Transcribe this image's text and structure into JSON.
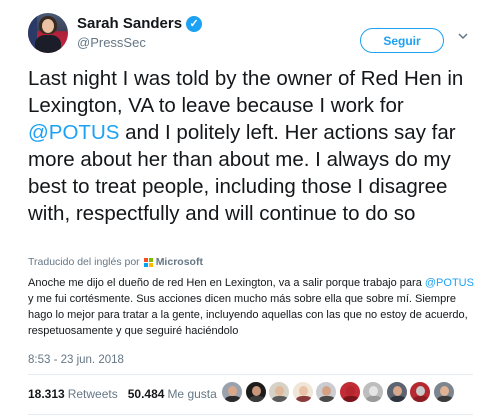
{
  "author": {
    "name": "Sarah Sanders",
    "verified_mark": "✓",
    "handle": "@PressSec"
  },
  "actions": {
    "follow_label": "Seguir",
    "more_icon": "chevron-down-icon"
  },
  "tweet": {
    "text_part1": "Last night I was told by the owner of Red Hen in Lexington, VA to leave because I work for ",
    "mention": "@POTUS",
    "text_part2": " and I politely left. Her actions say far more about her than about me. I always do my best to treat people, including those I disagree with, respectfully and will continue to do so"
  },
  "translation": {
    "label": "Traducido del inglés por",
    "provider": "Microsoft",
    "text_part1": "Anoche me dijo el dueño de red Hen en Lexington, va a salir porque trabajo para ",
    "mention": "@POTUS",
    "text_part2": " y me fui cortésmente. Sus acciones dicen mucho más sobre ella que sobre mí. Siempre hago lo mejor para tratar a la gente, incluyendo aquellas con las que no estoy de acuerdo, respetuosamente y que seguiré haciéndolo"
  },
  "timestamp": "8:53 - 23 jun. 2018",
  "stats": {
    "retweets_count": "18.313",
    "retweets_label": "Retweets",
    "likes_count": "50.484",
    "likes_label": "Me gusta"
  },
  "colors": {
    "accent": "#1da1f2",
    "text": "#14171a",
    "muted": "#657786",
    "ms_red": "#f25022",
    "ms_green": "#7fba00",
    "ms_blue": "#00a4ef",
    "ms_yellow": "#ffb900"
  },
  "likers": [
    {
      "face": "#d9a88a",
      "body": "#2b2b2b",
      "bg": "#9aa3ad"
    },
    {
      "face": "#c8967a",
      "body": "#3a3a3a",
      "bg": "#1c1c1c"
    },
    {
      "face": "#e2b89a",
      "body": "#5a5a5a",
      "bg": "#d7d2c8"
    },
    {
      "face": "#eac3a6",
      "body": "#8a3b3b",
      "bg": "#f0e6d8"
    },
    {
      "face": "#d4a185",
      "body": "#4a4a4a",
      "bg": "#c9ccd1"
    },
    {
      "face": "#b5262f",
      "body": "#7a141b",
      "bg": "#c22c35"
    },
    {
      "face": "#e5e5e5",
      "body": "#9a9a9a",
      "bg": "#bdbdbd"
    },
    {
      "face": "#d8a88c",
      "body": "#2e3440",
      "bg": "#5b6470"
    },
    {
      "face": "#c9c9c9",
      "body": "#8d1c22",
      "bg": "#b52a30"
    },
    {
      "face": "#dfb293",
      "body": "#3b3b3b",
      "bg": "#7d858f"
    }
  ]
}
